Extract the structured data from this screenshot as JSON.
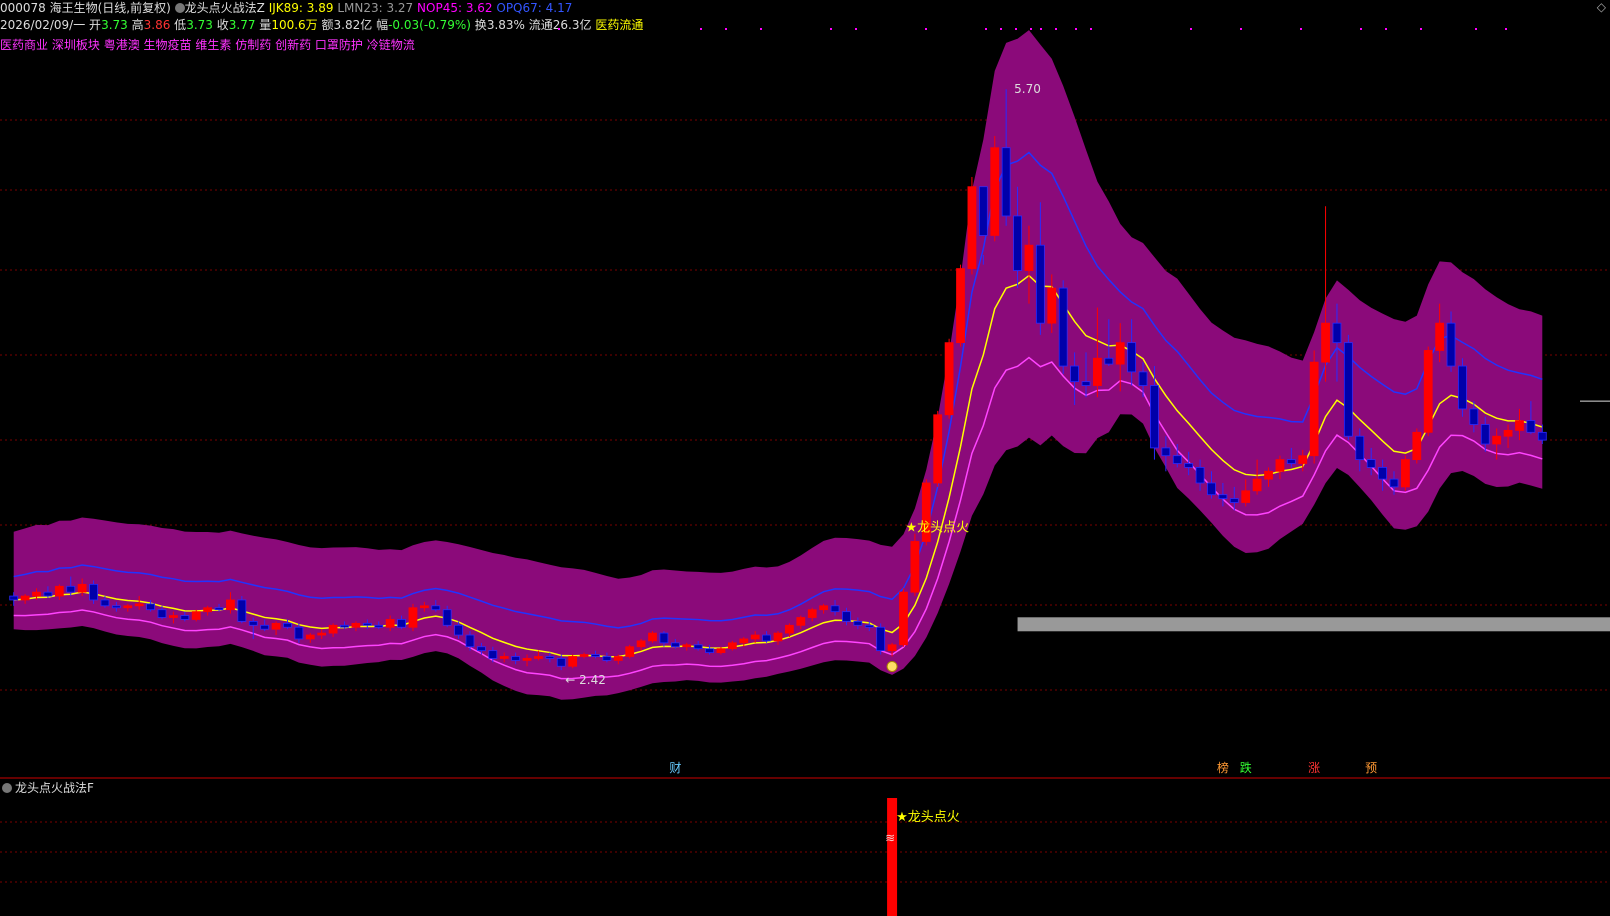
{
  "header": {
    "code_name": "000078 海王生物(日线,前复权)",
    "indicator_name": "龙头点火战法Z",
    "params": [
      {
        "label": "IJK89: 3.89",
        "color": "#ffff00"
      },
      {
        "label": "LMN23: 3.27",
        "color": "#999999"
      },
      {
        "label": "NOP45: 3.62",
        "color": "#ff00ff"
      },
      {
        "label": "OPQ67: 4.17",
        "color": "#3355ff"
      }
    ]
  },
  "quote": {
    "date": "2026/02/09/一",
    "open_label": "开",
    "open": "3.73",
    "high_label": "高",
    "high": "3.86",
    "low_label": "低",
    "low": "3.73",
    "close_label": "收",
    "close": "3.77",
    "volume_label": "量",
    "volume": "100.6万",
    "amount_label": "额",
    "amount": "3.82亿",
    "change_label": "幅",
    "change": "-0.03(-0.79%)",
    "turnover_label": "换",
    "turnover": "3.83%",
    "float_label": "流通",
    "float": "26.3亿",
    "sector": "医药流通"
  },
  "concepts": [
    "医药商业",
    "深圳板块",
    "粤港澳",
    "生物疫苗",
    "维生素",
    "仿制药",
    "创新药",
    "口罩防护",
    "冷链物流"
  ],
  "markers": {
    "max_label": "5.70",
    "min_label": "← 2.42",
    "signal_label": "★龙头点火",
    "sub_signal_label": "★龙头点火",
    "bottom_tags": [
      {
        "text": "财",
        "color": "#66ccff",
        "x_index": 58
      },
      {
        "text": "榜",
        "color": "#ff9933",
        "x_index": 106
      },
      {
        "text": "跌",
        "color": "#33ff33",
        "x_index": 108
      },
      {
        "text": "涨",
        "color": "#ff3333",
        "x_index": 114
      },
      {
        "text": "预",
        "color": "#ff9933",
        "x_index": 119
      }
    ]
  },
  "sub_panel": {
    "title": "龙头点火战法F"
  },
  "colors": {
    "up": "#ff0000",
    "down": "#0000aa",
    "band": "#8b0a7a",
    "mid_line": "#ffff00",
    "upper_line": "#2233ff",
    "lower_line": "#ff44ff",
    "grid": "#7a0000",
    "accent": "#ff00ff"
  },
  "chart_data": {
    "type": "candlestick",
    "title": "",
    "ylim": [
      2.3,
      5.85
    ],
    "candles": [
      [
        3.1,
        3.12,
        3.05,
        3.08
      ],
      [
        3.08,
        3.11,
        3.06,
        3.1
      ],
      [
        3.1,
        3.14,
        3.08,
        3.12
      ],
      [
        3.12,
        3.15,
        3.09,
        3.1
      ],
      [
        3.1,
        3.16,
        3.08,
        3.15
      ],
      [
        3.15,
        3.2,
        3.1,
        3.12
      ],
      [
        3.12,
        3.19,
        3.1,
        3.16
      ],
      [
        3.16,
        3.18,
        3.06,
        3.08
      ],
      [
        3.08,
        3.1,
        3.04,
        3.05
      ],
      [
        3.05,
        3.07,
        3.02,
        3.04
      ],
      [
        3.04,
        3.06,
        3.02,
        3.05
      ],
      [
        3.05,
        3.1,
        3.03,
        3.06
      ],
      [
        3.06,
        3.08,
        3.02,
        3.03
      ],
      [
        3.03,
        3.05,
        2.98,
        2.99
      ],
      [
        2.99,
        3.02,
        2.96,
        3.0
      ],
      [
        3.0,
        3.02,
        2.97,
        2.98
      ],
      [
        2.98,
        3.03,
        2.97,
        3.02
      ],
      [
        3.02,
        3.05,
        3.0,
        3.04
      ],
      [
        3.04,
        3.06,
        3.02,
        3.03
      ],
      [
        3.03,
        3.12,
        3.01,
        3.08
      ],
      [
        3.08,
        3.1,
        2.96,
        2.97
      ],
      [
        2.97,
        2.99,
        2.88,
        2.95
      ],
      [
        2.95,
        2.98,
        2.92,
        2.93
      ],
      [
        2.93,
        2.97,
        2.9,
        2.96
      ],
      [
        2.96,
        2.98,
        2.93,
        2.94
      ],
      [
        2.94,
        2.96,
        2.86,
        2.88
      ],
      [
        2.88,
        2.91,
        2.86,
        2.9
      ],
      [
        2.9,
        2.93,
        2.88,
        2.91
      ],
      [
        2.91,
        2.96,
        2.89,
        2.95
      ],
      [
        2.95,
        2.97,
        2.93,
        2.94
      ],
      [
        2.94,
        2.97,
        2.92,
        2.96
      ],
      [
        2.96,
        2.98,
        2.93,
        2.95
      ],
      [
        2.95,
        2.97,
        2.93,
        2.94
      ],
      [
        2.94,
        3.0,
        2.92,
        2.98
      ],
      [
        2.98,
        3.0,
        2.93,
        2.94
      ],
      [
        2.94,
        3.06,
        2.92,
        3.04
      ],
      [
        3.04,
        3.07,
        3.02,
        3.05
      ],
      [
        3.05,
        3.08,
        3.02,
        3.03
      ],
      [
        3.03,
        3.05,
        2.94,
        2.95
      ],
      [
        2.95,
        2.97,
        2.88,
        2.9
      ],
      [
        2.9,
        2.92,
        2.82,
        2.84
      ],
      [
        2.84,
        2.86,
        2.8,
        2.82
      ],
      [
        2.82,
        2.84,
        2.76,
        2.78
      ],
      [
        2.78,
        2.81,
        2.76,
        2.79
      ],
      [
        2.79,
        2.81,
        2.75,
        2.77
      ],
      [
        2.77,
        2.8,
        2.74,
        2.78
      ],
      [
        2.78,
        2.82,
        2.77,
        2.79
      ],
      [
        2.79,
        2.81,
        2.76,
        2.78
      ],
      [
        2.78,
        2.8,
        2.72,
        2.74
      ],
      [
        2.74,
        2.8,
        2.73,
        2.79
      ],
      [
        2.79,
        2.81,
        2.78,
        2.8
      ],
      [
        2.8,
        2.82,
        2.78,
        2.79
      ],
      [
        2.79,
        2.81,
        2.76,
        2.77
      ],
      [
        2.77,
        2.8,
        2.75,
        2.79
      ],
      [
        2.79,
        2.85,
        2.78,
        2.84
      ],
      [
        2.84,
        2.88,
        2.82,
        2.87
      ],
      [
        2.87,
        2.92,
        2.86,
        2.91
      ],
      [
        2.91,
        2.92,
        2.84,
        2.86
      ],
      [
        2.86,
        2.88,
        2.83,
        2.84
      ],
      [
        2.84,
        2.86,
        2.82,
        2.85
      ],
      [
        2.85,
        2.87,
        2.82,
        2.83
      ],
      [
        2.83,
        2.85,
        2.8,
        2.81
      ],
      [
        2.81,
        2.84,
        2.8,
        2.83
      ],
      [
        2.83,
        2.87,
        2.82,
        2.86
      ],
      [
        2.86,
        2.89,
        2.84,
        2.88
      ],
      [
        2.88,
        2.92,
        2.86,
        2.9
      ],
      [
        2.9,
        2.92,
        2.86,
        2.87
      ],
      [
        2.87,
        2.92,
        2.85,
        2.91
      ],
      [
        2.91,
        2.96,
        2.89,
        2.95
      ],
      [
        2.95,
        3.0,
        2.93,
        2.99
      ],
      [
        2.99,
        3.04,
        2.97,
        3.03
      ],
      [
        3.03,
        3.06,
        3.01,
        3.05
      ],
      [
        3.05,
        3.08,
        3.0,
        3.02
      ],
      [
        3.02,
        3.04,
        2.95,
        2.97
      ],
      [
        2.97,
        2.99,
        2.93,
        2.95
      ],
      [
        2.95,
        2.97,
        2.92,
        2.94
      ],
      [
        2.94,
        2.96,
        2.8,
        2.82
      ],
      [
        2.82,
        2.86,
        2.79,
        2.85
      ],
      [
        2.85,
        3.14,
        2.84,
        3.12
      ],
      [
        3.12,
        3.42,
        3.1,
        3.38
      ],
      [
        3.38,
        3.7,
        3.36,
        3.68
      ],
      [
        3.68,
        4.05,
        3.66,
        4.03
      ],
      [
        4.03,
        4.42,
        4.01,
        4.4
      ],
      [
        4.4,
        4.8,
        4.38,
        4.78
      ],
      [
        4.78,
        5.25,
        4.75,
        5.2
      ],
      [
        5.2,
        4.85,
        4.8,
        4.95
      ],
      [
        4.95,
        5.46,
        4.92,
        5.4
      ],
      [
        5.4,
        5.7,
        5.0,
        5.05
      ],
      [
        5.05,
        5.2,
        4.68,
        4.77
      ],
      [
        4.77,
        5.0,
        4.6,
        4.9
      ],
      [
        4.9,
        5.12,
        4.44,
        4.5
      ],
      [
        4.5,
        4.75,
        4.45,
        4.68
      ],
      [
        4.68,
        4.72,
        4.24,
        4.28
      ],
      [
        4.28,
        4.35,
        4.08,
        4.2
      ],
      [
        4.2,
        4.35,
        4.12,
        4.18
      ],
      [
        4.18,
        4.58,
        4.12,
        4.32
      ],
      [
        4.32,
        4.52,
        4.28,
        4.29
      ],
      [
        4.29,
        4.5,
        4.15,
        4.4
      ],
      [
        4.4,
        4.52,
        4.18,
        4.25
      ],
      [
        4.25,
        4.3,
        4.12,
        4.18
      ],
      [
        4.18,
        4.28,
        3.8,
        3.86
      ],
      [
        3.86,
        3.92,
        3.74,
        3.82
      ],
      [
        3.82,
        3.88,
        3.76,
        3.78
      ],
      [
        3.78,
        3.84,
        3.72,
        3.76
      ],
      [
        3.76,
        3.8,
        3.64,
        3.68
      ],
      [
        3.68,
        3.74,
        3.6,
        3.62
      ],
      [
        3.62,
        3.68,
        3.56,
        3.6
      ],
      [
        3.6,
        3.66,
        3.54,
        3.58
      ],
      [
        3.58,
        3.7,
        3.56,
        3.64
      ],
      [
        3.64,
        3.8,
        3.62,
        3.7
      ],
      [
        3.7,
        3.76,
        3.66,
        3.74
      ],
      [
        3.74,
        3.82,
        3.7,
        3.8
      ],
      [
        3.8,
        3.86,
        3.76,
        3.78
      ],
      [
        3.78,
        3.85,
        3.74,
        3.82
      ],
      [
        3.82,
        4.36,
        3.78,
        4.3
      ],
      [
        4.3,
        5.1,
        4.2,
        4.5
      ],
      [
        4.5,
        4.6,
        4.2,
        4.4
      ],
      [
        4.4,
        4.44,
        3.9,
        3.92
      ],
      [
        3.92,
        3.96,
        3.74,
        3.8
      ],
      [
        3.8,
        3.86,
        3.72,
        3.76
      ],
      [
        3.76,
        3.8,
        3.64,
        3.7
      ],
      [
        3.7,
        3.74,
        3.62,
        3.66
      ],
      [
        3.66,
        3.82,
        3.64,
        3.8
      ],
      [
        3.8,
        3.96,
        3.78,
        3.94
      ],
      [
        3.94,
        4.38,
        3.92,
        4.36
      ],
      [
        4.36,
        4.6,
        4.3,
        4.5
      ],
      [
        4.5,
        4.56,
        4.25,
        4.28
      ],
      [
        4.28,
        4.32,
        4.02,
        4.06
      ],
      [
        4.06,
        4.1,
        3.94,
        3.98
      ],
      [
        3.98,
        4.02,
        3.84,
        3.88
      ],
      [
        3.88,
        3.96,
        3.8,
        3.92
      ],
      [
        3.92,
        3.98,
        3.86,
        3.95
      ],
      [
        3.95,
        4.06,
        3.9,
        4.0
      ],
      [
        4.0,
        4.1,
        3.93,
        3.94
      ],
      [
        3.94,
        3.98,
        3.88,
        3.9
      ]
    ]
  }
}
